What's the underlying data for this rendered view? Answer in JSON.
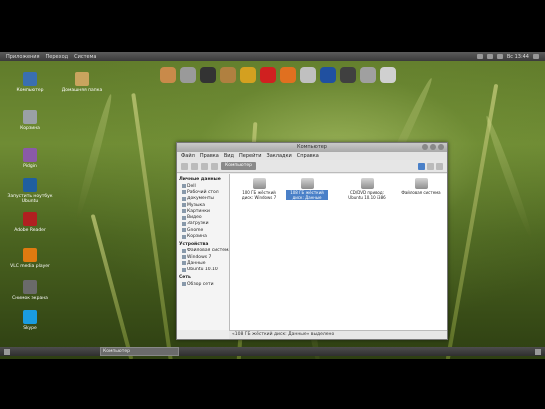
{
  "top_panel": {
    "menus": [
      "Приложения",
      "Переход",
      "Система"
    ],
    "clock": "Вс 13:44"
  },
  "desktop_icons": [
    {
      "label": "Компьютер",
      "icon": "monitor-icon",
      "color": "#3a6fb0"
    },
    {
      "label": "Домашняя папка",
      "icon": "folder-icon",
      "color": "#c9a45e"
    },
    {
      "label": "Корзина",
      "icon": "trash-icon",
      "color": "#9aa0a6"
    },
    {
      "label": "Pidgin",
      "icon": "pidgin-icon",
      "color": "#8a5aa8"
    },
    {
      "label": "Запустить ноутбук Ubuntu",
      "icon": "ubuntu-icon",
      "color": "#1f5fa0"
    },
    {
      "label": "Adobe Reader",
      "icon": "adobe-icon",
      "color": "#b02020"
    },
    {
      "label": "VLC media player",
      "icon": "vlc-icon",
      "color": "#e07a10"
    },
    {
      "label": "Снимок экрана",
      "icon": "screenshot-icon",
      "color": "#6a6a6a"
    },
    {
      "label": "Skype",
      "icon": "skype-icon",
      "color": "#1a9ce0"
    }
  ],
  "dock_icons": [
    {
      "name": "home-icon",
      "color": "#c98a4a"
    },
    {
      "name": "settings-icon",
      "color": "#9a9a9a"
    },
    {
      "name": "x-icon",
      "color": "#333333"
    },
    {
      "name": "image-icon",
      "color": "#b08040"
    },
    {
      "name": "terminal-icon",
      "color": "#d4a020"
    },
    {
      "name": "media-icon",
      "color": "#d02020"
    },
    {
      "name": "firefox-icon",
      "color": "#e07020"
    },
    {
      "name": "chat-icon",
      "color": "#c0c0c0"
    },
    {
      "name": "globe-icon",
      "color": "#2050a0"
    },
    {
      "name": "monitor-icon",
      "color": "#404040"
    },
    {
      "name": "gear-icon",
      "color": "#a0a0a0"
    },
    {
      "name": "ubuntu-icon",
      "color": "#d0d0d0"
    }
  ],
  "window": {
    "title": "Компьютер",
    "menu": [
      "Файл",
      "Правка",
      "Вид",
      "Перейти",
      "Закладки",
      "Справка"
    ],
    "location": "Компьютер",
    "sidebar": {
      "sections": [
        {
          "heading": "Личные данные",
          "items": [
            "Dell",
            "Рабочий стол",
            "Документы",
            "Музыка",
            "Картинки",
            "Видео",
            "Загрузки",
            "Gnome",
            "Корзина"
          ]
        },
        {
          "heading": "Устройства",
          "items": [
            "Файловая система",
            "Windows 7",
            "Данные",
            "Ubuntu 10.10"
          ]
        },
        {
          "heading": "Сеть",
          "items": [
            "Обзор сети"
          ]
        }
      ]
    },
    "drives": [
      {
        "label": "100 ГБ жёсткий диск: Windows 7",
        "selected": false
      },
      {
        "label": "108 ГБ жёсткий диск: Данные",
        "selected": true
      },
      {
        "label": "CD/DVD привод: Ubuntu 10.10 i386",
        "selected": false
      },
      {
        "label": "Файловая система",
        "selected": false
      }
    ],
    "status": "«108 ГБ жёсткий диск: Данные» выделено"
  },
  "bottom_panel": {
    "task": "Компьютер"
  }
}
